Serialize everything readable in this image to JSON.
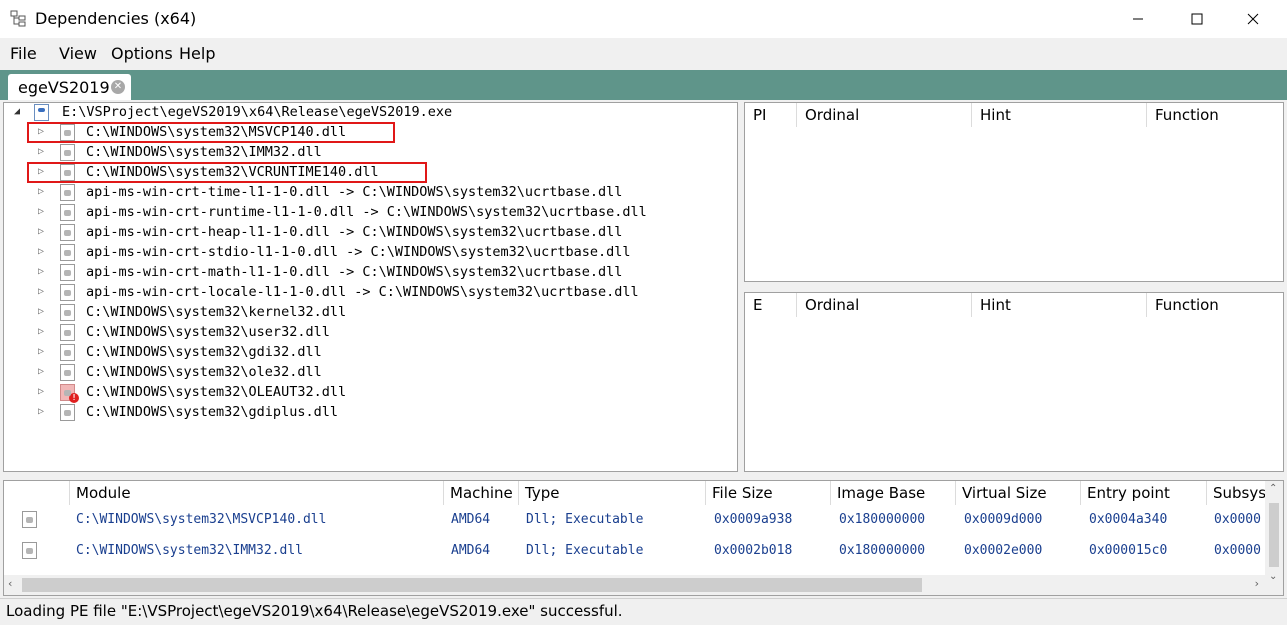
{
  "window": {
    "title": "Dependencies (x64)",
    "accent": "#5f958a"
  },
  "menu": [
    "File",
    "View",
    "Options",
    "Help"
  ],
  "tab": {
    "label": "egeVS2019",
    "close_icon": "close-icon"
  },
  "tree": {
    "root": "E:\\VSProject\\egeVS2019\\x64\\Release\\egeVS2019.exe",
    "items": [
      {
        "label": "C:\\WINDOWS\\system32\\MSVCP140.dll",
        "highlighted": true,
        "error": false
      },
      {
        "label": "C:\\WINDOWS\\system32\\IMM32.dll",
        "highlighted": false,
        "error": false
      },
      {
        "label": "C:\\WINDOWS\\system32\\VCRUNTIME140.dll",
        "highlighted": true,
        "error": false
      },
      {
        "label": "api-ms-win-crt-time-l1-1-0.dll -> C:\\WINDOWS\\system32\\ucrtbase.dll",
        "highlighted": false,
        "error": false
      },
      {
        "label": "api-ms-win-crt-runtime-l1-1-0.dll -> C:\\WINDOWS\\system32\\ucrtbase.dll",
        "highlighted": false,
        "error": false
      },
      {
        "label": "api-ms-win-crt-heap-l1-1-0.dll -> C:\\WINDOWS\\system32\\ucrtbase.dll",
        "highlighted": false,
        "error": false
      },
      {
        "label": "api-ms-win-crt-stdio-l1-1-0.dll -> C:\\WINDOWS\\system32\\ucrtbase.dll",
        "highlighted": false,
        "error": false
      },
      {
        "label": "api-ms-win-crt-math-l1-1-0.dll -> C:\\WINDOWS\\system32\\ucrtbase.dll",
        "highlighted": false,
        "error": false
      },
      {
        "label": "api-ms-win-crt-locale-l1-1-0.dll -> C:\\WINDOWS\\system32\\ucrtbase.dll",
        "highlighted": false,
        "error": false
      },
      {
        "label": "C:\\WINDOWS\\system32\\kernel32.dll",
        "highlighted": false,
        "error": false
      },
      {
        "label": "C:\\WINDOWS\\system32\\user32.dll",
        "highlighted": false,
        "error": false
      },
      {
        "label": "C:\\WINDOWS\\system32\\gdi32.dll",
        "highlighted": false,
        "error": false
      },
      {
        "label": "C:\\WINDOWS\\system32\\ole32.dll",
        "highlighted": false,
        "error": false
      },
      {
        "label": "C:\\WINDOWS\\system32\\OLEAUT32.dll",
        "highlighted": false,
        "error": true
      },
      {
        "label": "C:\\WINDOWS\\system32\\gdiplus.dll",
        "highlighted": false,
        "error": false
      }
    ]
  },
  "imports_grid": {
    "columns": [
      "PI",
      "Ordinal",
      "Hint",
      "Function"
    ]
  },
  "exports_grid": {
    "columns": [
      "E",
      "Ordinal",
      "Hint",
      "Function"
    ]
  },
  "modules": {
    "columns": [
      "Module",
      "Machine",
      "Type",
      "File Size",
      "Image Base",
      "Virtual Size",
      "Entry point",
      "Subsys"
    ],
    "rows": [
      [
        "C:\\WINDOWS\\system32\\MSVCP140.dll",
        "AMD64",
        "Dll; Executable",
        "0x0009a938",
        "0x180000000",
        "0x0009d000",
        "0x0004a340",
        "0x0000"
      ],
      [
        "C:\\WINDOWS\\system32\\IMM32.dll",
        "AMD64",
        "Dll; Executable",
        "0x0002b018",
        "0x180000000",
        "0x0002e000",
        "0x000015c0",
        "0x0000"
      ]
    ]
  },
  "status": "Loading PE file \"E:\\VSProject\\egeVS2019\\x64\\Release\\egeVS2019.exe\" successful."
}
